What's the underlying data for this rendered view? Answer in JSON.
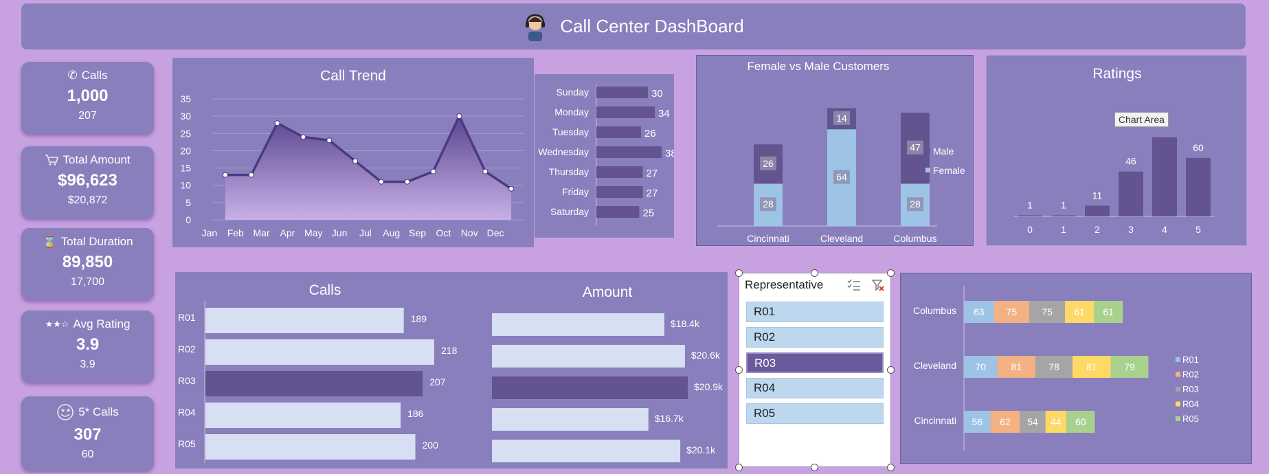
{
  "header": {
    "title": "Call Center DashBoard",
    "icon": "agent-headset-icon"
  },
  "kpis": [
    {
      "label": "Calls",
      "value": "1,000",
      "sub": "207",
      "icon": "phone-icon"
    },
    {
      "label": "Total Amount",
      "value": "$96,623",
      "sub": "$20,872",
      "icon": "cart-icon"
    },
    {
      "label": "Total Duration",
      "value": "89,850",
      "sub": "17,700",
      "icon": "hourglass-icon"
    },
    {
      "label": "Avg Rating",
      "value": "3.9",
      "sub": "3.9",
      "icon": "stars-icon",
      "icon_text": "★★☆"
    },
    {
      "label": "5* Calls",
      "value": "307",
      "sub": "60",
      "icon": "star-eyes-icon"
    }
  ],
  "colors": {
    "background": "#c8a2e0",
    "panel": "#8a7fbd",
    "dark_bar": "#63548f",
    "light_bar": "#d6e0f2",
    "female": "#9dc3e6"
  },
  "chart_data": [
    {
      "type": "area",
      "title": "Call Trend",
      "categories": [
        "Jan",
        "Feb",
        "Mar",
        "Apr",
        "May",
        "Jun",
        "Jul",
        "Aug",
        "Sep",
        "Oct",
        "Nov",
        "Dec"
      ],
      "values": [
        13,
        13,
        28,
        24,
        23,
        17,
        11,
        11,
        14,
        30,
        14,
        9
      ],
      "ylim": [
        0,
        35
      ],
      "yticks": [
        0,
        5,
        10,
        15,
        20,
        25,
        30,
        35
      ],
      "grid": true
    },
    {
      "type": "bar",
      "orientation": "horizontal",
      "categories": [
        "Sunday",
        "Monday",
        "Tuesday",
        "Wednesday",
        "Thursday",
        "Friday",
        "Saturday"
      ],
      "values": [
        30,
        34,
        26,
        38,
        27,
        27,
        25
      ]
    },
    {
      "type": "bar",
      "stacked": true,
      "title": "Female vs Male Customers",
      "categories": [
        "Cincinnati",
        "Cleveland",
        "Columbus"
      ],
      "series": [
        {
          "name": "Female",
          "values": [
            28,
            64,
            28
          ]
        },
        {
          "name": "Male",
          "values": [
            26,
            14,
            47
          ]
        }
      ],
      "legend": "right"
    },
    {
      "type": "bar",
      "title": "Ratings",
      "categories": [
        "0",
        "1",
        "2",
        "3",
        "4",
        "5"
      ],
      "values": [
        1,
        1,
        11,
        46,
        81,
        60
      ],
      "value_labels": [
        "1",
        "1",
        "11",
        "46",
        "",
        "60"
      ],
      "tooltip": "Chart Area"
    },
    {
      "type": "bar",
      "orientation": "horizontal",
      "title": "Calls",
      "categories": [
        "R01",
        "R02",
        "R03",
        "R04",
        "R05"
      ],
      "values": [
        189,
        218,
        207,
        186,
        200
      ],
      "highlighted": "R03"
    },
    {
      "type": "bar",
      "orientation": "horizontal",
      "title": "Amount",
      "categories": [
        "R01",
        "R02",
        "R03",
        "R04",
        "R05"
      ],
      "values": [
        18.4,
        20.6,
        20.9,
        16.7,
        20.1
      ],
      "value_labels": [
        "$18.4k",
        "$20.6k",
        "$20.9k",
        "$16.7k",
        "$20.1k"
      ],
      "highlighted": "R03"
    },
    {
      "type": "bar",
      "orientation": "horizontal",
      "stacked": true,
      "categories": [
        "Columbus",
        "Cleveland",
        "Cincinnati"
      ],
      "series": [
        {
          "name": "R01",
          "values": [
            63,
            70,
            56
          ],
          "color": "#9dc3e6"
        },
        {
          "name": "R02",
          "values": [
            75,
            81,
            62
          ],
          "color": "#f4b183"
        },
        {
          "name": "R03",
          "values": [
            75,
            78,
            54
          ],
          "color": "#a5a5a5"
        },
        {
          "name": "R04",
          "values": [
            61,
            81,
            44
          ],
          "color": "#ffd966"
        },
        {
          "name": "R05",
          "values": [
            61,
            79,
            60
          ],
          "color": "#a9d18e"
        }
      ],
      "legend": "right"
    }
  ],
  "slicer": {
    "title": "Representative",
    "items": [
      "R01",
      "R02",
      "R03",
      "R04",
      "R05"
    ],
    "selected": "R03"
  }
}
